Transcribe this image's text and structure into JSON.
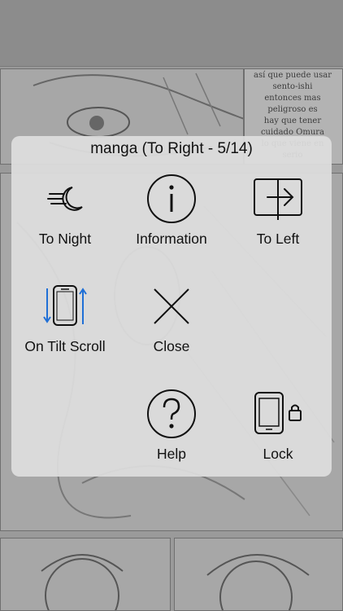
{
  "background": {
    "caption_lines": "así que puede usar\nsento-ishi\nentonces mas\npeligroso es\nhay que tener\ncuidado Omura\nlo que viene en\nserio"
  },
  "menu": {
    "title": "manga (To Right - 5/14)",
    "items": [
      {
        "label": "To Night",
        "icon": "moon-wind-icon"
      },
      {
        "label": "Information",
        "icon": "info-circle-icon"
      },
      {
        "label": "To Left",
        "icon": "book-arrow-icon"
      },
      {
        "label": "On Tilt Scroll",
        "icon": "phone-tilt-icon"
      },
      {
        "label": "Close",
        "icon": "close-x-icon"
      },
      {
        "label": "Help",
        "icon": "help-circle-icon"
      },
      {
        "label": "Lock",
        "icon": "tablet-lock-icon"
      }
    ]
  },
  "colors": {
    "accent_blue": "#1f6fd6",
    "icon_stroke": "#111111",
    "overlay_bg": "#dedede"
  }
}
